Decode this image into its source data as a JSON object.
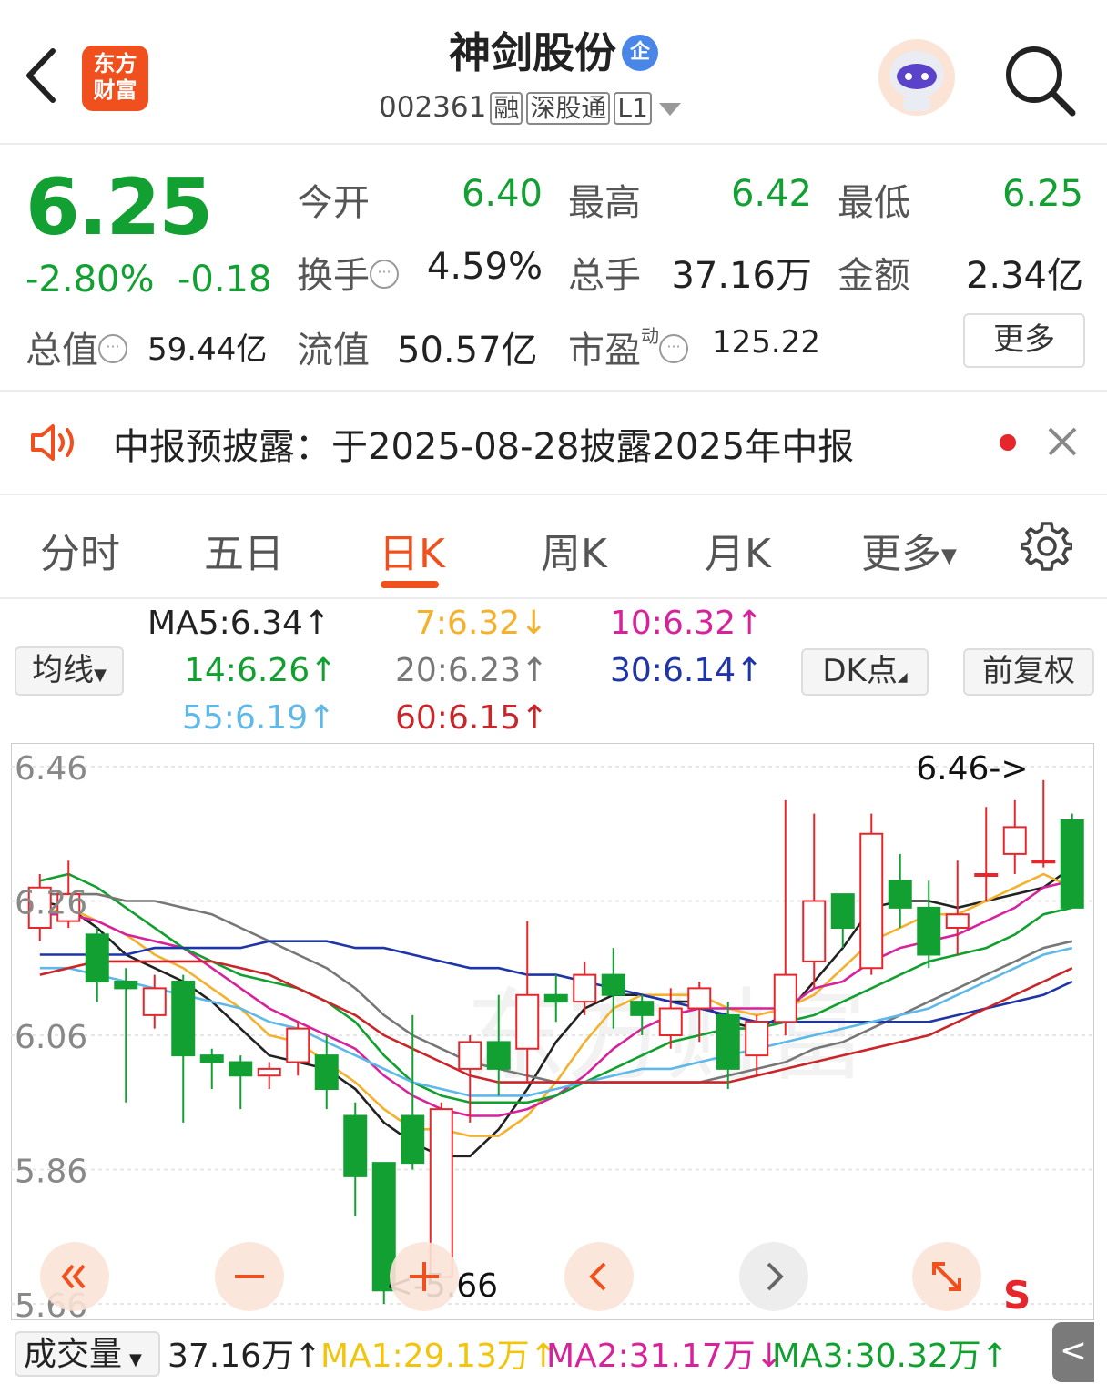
{
  "header": {
    "logo_line1": "东方",
    "logo_line2": "财富",
    "title": "神剑股份",
    "title_badge": "企",
    "code": "002361",
    "tags": [
      "融",
      "深股通",
      "L1"
    ]
  },
  "quote": {
    "price": "6.25",
    "change_pct": "-2.80%",
    "change_abs": "-0.18",
    "open_label": "今开",
    "open_value": "6.40",
    "high_label": "最高",
    "high_value": "6.42",
    "low_label": "最低",
    "low_value": "6.25",
    "turnover_label": "换手",
    "turnover_value": "4.59%",
    "volume_label": "总手",
    "volume_value": "37.16万",
    "amount_label": "金额",
    "amount_value": "2.34亿",
    "mktcap_label": "总值",
    "mktcap_value": "59.44亿",
    "float_label": "流值",
    "float_value": "50.57亿",
    "pe_label": "市盈",
    "pe_sup": "动",
    "pe_value": "125.22",
    "more_label": "更多"
  },
  "notice": {
    "text": "中报预披露：于2025-08-28披露2025年中报"
  },
  "tabs": [
    "分时",
    "五日",
    "日K",
    "周K",
    "月K",
    "更多"
  ],
  "active_tab": "日K",
  "ma_panel": {
    "selector_label": "均线",
    "dk_label": "DK点",
    "adjust_label": "前复权",
    "items": [
      {
        "text": "MA5:6.34↑",
        "color": "#222222"
      },
      {
        "text": "7:6.32↓",
        "color": "#f3b12e"
      },
      {
        "text": "10:6.32↑",
        "color": "#d6239b"
      },
      {
        "text": "14:6.26↑",
        "color": "#11a02f"
      },
      {
        "text": "20:6.23↑",
        "color": "#777777"
      },
      {
        "text": "30:6.14↑",
        "color": "#1e35a8"
      },
      {
        "text": "55:6.19↑",
        "color": "#5eb8e8"
      },
      {
        "text": "60:6.15↑",
        "color": "#c8262a"
      }
    ]
  },
  "chart_data": {
    "type": "candlestick",
    "y_axis_labels": [
      "6.46",
      "6.26",
      "6.06",
      "5.86",
      "5.66"
    ],
    "ylim": [
      5.66,
      6.46
    ],
    "max_annotation": "6.46->",
    "min_annotation": "<-5.66",
    "candles": [
      {
        "o": 6.22,
        "c": 6.28,
        "h": 6.3,
        "l": 6.2
      },
      {
        "o": 6.23,
        "c": 6.27,
        "h": 6.32,
        "l": 6.22
      },
      {
        "o": 6.21,
        "c": 6.14,
        "h": 6.22,
        "l": 6.11
      },
      {
        "o": 6.14,
        "c": 6.13,
        "h": 6.16,
        "l": 5.96
      },
      {
        "o": 6.09,
        "c": 6.13,
        "h": 6.15,
        "l": 6.07
      },
      {
        "o": 6.14,
        "c": 6.03,
        "h": 6.15,
        "l": 5.93
      },
      {
        "o": 6.03,
        "c": 6.02,
        "h": 6.04,
        "l": 5.98
      },
      {
        "o": 6.02,
        "c": 6.0,
        "h": 6.03,
        "l": 5.95
      },
      {
        "o": 6.0,
        "c": 6.01,
        "h": 6.02,
        "l": 5.98
      },
      {
        "o": 6.02,
        "c": 6.07,
        "h": 6.08,
        "l": 6.0
      },
      {
        "o": 6.03,
        "c": 5.98,
        "h": 6.06,
        "l": 5.95
      },
      {
        "o": 5.94,
        "c": 5.85,
        "h": 5.96,
        "l": 5.79
      },
      {
        "o": 5.87,
        "c": 5.68,
        "h": 5.87,
        "l": 5.66
      },
      {
        "o": 5.94,
        "c": 5.87,
        "h": 6.09,
        "l": 5.86
      },
      {
        "o": 5.7,
        "c": 5.95,
        "h": 5.96,
        "l": 5.7
      },
      {
        "o": 6.01,
        "c": 6.05,
        "h": 6.06,
        "l": 5.93
      },
      {
        "o": 6.05,
        "c": 6.01,
        "h": 6.12,
        "l": 5.97
      },
      {
        "o": 6.04,
        "c": 6.12,
        "h": 6.23,
        "l": 5.99
      },
      {
        "o": 6.12,
        "c": 6.11,
        "h": 6.15,
        "l": 6.08
      },
      {
        "o": 6.11,
        "c": 6.15,
        "h": 6.17,
        "l": 6.09
      },
      {
        "o": 6.15,
        "c": 6.12,
        "h": 6.19,
        "l": 6.07
      },
      {
        "o": 6.11,
        "c": 6.09,
        "h": 6.12,
        "l": 6.06
      },
      {
        "o": 6.06,
        "c": 6.1,
        "h": 6.13,
        "l": 6.04
      },
      {
        "o": 6.1,
        "c": 6.13,
        "h": 6.14,
        "l": 6.05
      },
      {
        "o": 6.09,
        "c": 6.01,
        "h": 6.11,
        "l": 5.98
      },
      {
        "o": 6.03,
        "c": 6.08,
        "h": 6.09,
        "l": 6.0
      },
      {
        "o": 6.08,
        "c": 6.15,
        "h": 6.41,
        "l": 6.06
      },
      {
        "o": 6.17,
        "c": 6.26,
        "h": 6.39,
        "l": 6.13
      },
      {
        "o": 6.27,
        "c": 6.22,
        "h": 6.27,
        "l": 6.19
      },
      {
        "o": 6.16,
        "c": 6.36,
        "h": 6.39,
        "l": 6.15
      },
      {
        "o": 6.29,
        "c": 6.25,
        "h": 6.33,
        "l": 6.22
      },
      {
        "o": 6.25,
        "c": 6.18,
        "h": 6.29,
        "l": 6.16
      },
      {
        "o": 6.22,
        "c": 6.24,
        "h": 6.32,
        "l": 6.18
      },
      {
        "o": 6.3,
        "c": 6.3,
        "h": 6.4,
        "l": 6.26
      },
      {
        "o": 6.33,
        "c": 6.37,
        "h": 6.41,
        "l": 6.3
      },
      {
        "o": 6.32,
        "c": 6.32,
        "h": 6.44,
        "l": 6.31
      },
      {
        "o": 6.38,
        "c": 6.25,
        "h": 6.39,
        "l": 6.25
      }
    ],
    "ma_lines": [
      {
        "name": "MA5",
        "color": "#222222",
        "values": [
          6.26,
          6.25,
          6.22,
          6.18,
          6.16,
          6.14,
          6.11,
          6.07,
          6.03,
          6.02,
          6.01,
          5.98,
          5.93,
          5.9,
          5.88,
          5.88,
          5.92,
          5.98,
          6.05,
          6.1,
          6.12,
          6.12,
          6.11,
          6.11,
          6.08,
          6.07,
          6.09,
          6.14,
          6.19,
          6.25,
          6.26,
          6.26,
          6.25,
          6.26,
          6.27,
          6.28,
          6.31
        ]
      },
      {
        "name": "7",
        "color": "#f3b12e",
        "values": [
          6.24,
          6.25,
          6.23,
          6.21,
          6.18,
          6.16,
          6.13,
          6.1,
          6.06,
          6.05,
          6.02,
          5.99,
          5.95,
          5.92,
          5.92,
          5.91,
          5.91,
          5.94,
          5.99,
          6.05,
          6.1,
          6.12,
          6.12,
          6.12,
          6.1,
          6.09,
          6.1,
          6.12,
          6.16,
          6.2,
          6.22,
          6.24,
          6.24,
          6.26,
          6.28,
          6.3,
          6.28
        ]
      },
      {
        "name": "10",
        "color": "#d6239b",
        "values": [
          6.24,
          6.24,
          6.23,
          6.21,
          6.2,
          6.19,
          6.16,
          6.13,
          6.1,
          6.08,
          6.06,
          6.04,
          6.0,
          5.97,
          5.95,
          5.94,
          5.94,
          5.95,
          5.97,
          6.0,
          6.04,
          6.07,
          6.09,
          6.1,
          6.1,
          6.1,
          6.1,
          6.13,
          6.14,
          6.17,
          6.19,
          6.2,
          6.21,
          6.23,
          6.25,
          6.28,
          6.29
        ]
      },
      {
        "name": "14",
        "color": "#11a02f",
        "values": [
          6.29,
          6.3,
          6.28,
          6.25,
          6.22,
          6.19,
          6.17,
          6.15,
          6.14,
          6.13,
          6.11,
          6.08,
          6.03,
          5.99,
          5.97,
          5.96,
          5.96,
          5.96,
          5.97,
          5.99,
          6.01,
          6.03,
          6.05,
          6.06,
          6.07,
          6.07,
          6.08,
          6.09,
          6.11,
          6.13,
          6.15,
          6.17,
          6.18,
          6.19,
          6.21,
          6.24,
          6.25
        ]
      },
      {
        "name": "20",
        "color": "#777777",
        "values": [
          6.27,
          6.27,
          6.27,
          6.26,
          6.26,
          6.25,
          6.24,
          6.22,
          6.2,
          6.18,
          6.16,
          6.13,
          6.09,
          6.06,
          6.04,
          6.02,
          6.01,
          6.0,
          5.99,
          5.99,
          5.99,
          5.99,
          5.99,
          5.99,
          6.0,
          6.01,
          6.02,
          6.04,
          6.05,
          6.07,
          6.09,
          6.11,
          6.13,
          6.15,
          6.17,
          6.19,
          6.2
        ]
      },
      {
        "name": "30",
        "color": "#1e35a8",
        "values": [
          6.18,
          6.18,
          6.18,
          6.18,
          6.19,
          6.19,
          6.19,
          6.19,
          6.2,
          6.2,
          6.2,
          6.19,
          6.19,
          6.18,
          6.17,
          6.16,
          6.16,
          6.15,
          6.15,
          6.14,
          6.13,
          6.12,
          6.11,
          6.1,
          6.09,
          6.08,
          6.08,
          6.08,
          6.08,
          6.08,
          6.08,
          6.08,
          6.09,
          6.1,
          6.11,
          6.12,
          6.14
        ]
      },
      {
        "name": "55",
        "color": "#5eb8e8",
        "values": [
          6.16,
          6.16,
          6.15,
          6.14,
          6.13,
          6.12,
          6.11,
          6.1,
          6.08,
          6.07,
          6.05,
          6.03,
          6.01,
          5.99,
          5.98,
          5.97,
          5.97,
          5.97,
          5.98,
          5.99,
          6.0,
          6.01,
          6.01,
          6.02,
          6.03,
          6.04,
          6.05,
          6.06,
          6.07,
          6.08,
          6.09,
          6.1,
          6.12,
          6.14,
          6.16,
          6.18,
          6.19
        ]
      },
      {
        "name": "60",
        "color": "#c8262a",
        "values": [
          6.15,
          6.16,
          6.17,
          6.17,
          6.17,
          6.17,
          6.17,
          6.16,
          6.15,
          6.13,
          6.11,
          6.09,
          6.06,
          6.04,
          6.02,
          6.0,
          5.99,
          5.99,
          5.99,
          5.99,
          5.99,
          5.99,
          5.99,
          5.99,
          5.99,
          6.0,
          6.01,
          6.02,
          6.03,
          6.04,
          6.05,
          6.06,
          6.08,
          6.1,
          6.12,
          6.14,
          6.16
        ]
      }
    ]
  },
  "volume_panel": {
    "selector_label": "成交量",
    "value": "37.16万↑",
    "ma1": {
      "text": "MA1:29.13万↑",
      "color": "#f1c40f"
    },
    "ma2": {
      "text": "MA2:31.17万↓",
      "color": "#d6239b"
    },
    "ma3": {
      "text": "MA3:30.32万↑",
      "color": "#11a02f"
    }
  },
  "controls": {
    "s_label": "S",
    "side_label": "<"
  },
  "colors": {
    "up": "#e5262b",
    "down": "#13a032",
    "accent": "#f0501e"
  }
}
